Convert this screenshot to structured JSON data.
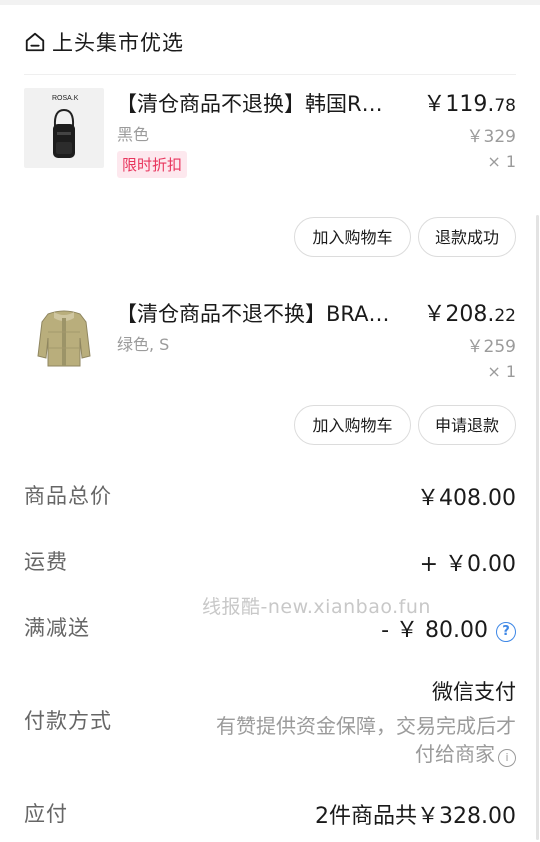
{
  "shop": {
    "name": "上头集市优选",
    "icon": "shop-icon"
  },
  "items": [
    {
      "title": "【清仓商品不退换】韩国R…",
      "thumb_brand": "ROSA.K",
      "sku": "黑色",
      "price_int": "￥119.",
      "price_dec": "78",
      "original_price": "￥329",
      "quantity": "× 1",
      "tag": "限时折扣",
      "buttons": [
        "加入购物车",
        "退款成功"
      ]
    },
    {
      "title": "【清仓商品不退不换】BRA…",
      "sku": "绿色, S",
      "price_int": "￥208.",
      "price_dec": "22",
      "original_price": "￥259",
      "quantity": "× 1",
      "buttons": [
        "加入购物车",
        "申请退款"
      ]
    }
  ],
  "summary": {
    "total_label": "商品总价",
    "total_value": "￥408.00",
    "shipping_label": "运费",
    "shipping_value": "+ ￥0.00",
    "discount_label": "满减送",
    "discount_value": "- ￥ 80.00",
    "payment_label": "付款方式",
    "payment_method": "微信支付",
    "payment_note_line1": "有赞提供资金保障，交易完成后才",
    "payment_note_line2": "付给商家",
    "due_label": "应付",
    "due_value": "2件商品共￥328.00"
  },
  "watermark": "线报酷-new.xianbao.fun",
  "colors": {
    "tag_bg": "#fde8ee",
    "tag_text": "#e8355d",
    "help_blue": "#3f88e6"
  }
}
